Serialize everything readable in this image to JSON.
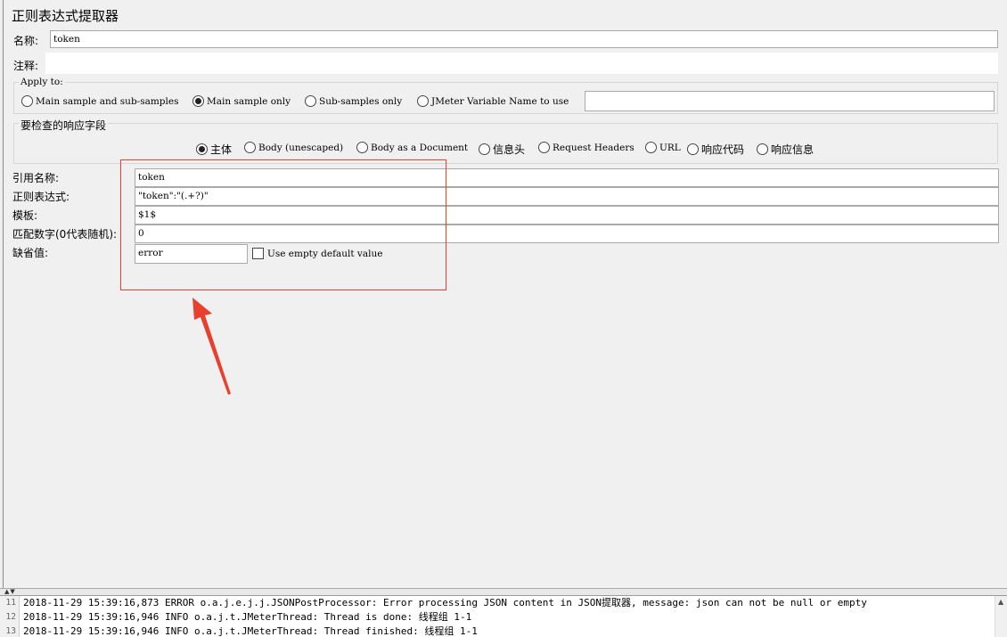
{
  "panel": {
    "title": "正则表达式提取器"
  },
  "name_field": {
    "label": "名称:",
    "value": "token"
  },
  "comment_field": {
    "label": "注释:",
    "value": ""
  },
  "apply_to": {
    "legend": "Apply to:",
    "options": [
      "Main sample and sub-samples",
      "Main sample only",
      "Sub-samples only",
      "JMeter Variable Name to use"
    ],
    "selected": "Main sample only",
    "variable_name": ""
  },
  "response_field": {
    "legend": "要检查的响应字段",
    "options": [
      "主体",
      "Body (unescaped)",
      "Body as a Document",
      "信息头",
      "Request Headers",
      "URL",
      "响应代码",
      "响应信息"
    ],
    "selected": "主体"
  },
  "params": {
    "ref_name": {
      "label": "引用名称:",
      "value": "token"
    },
    "regex": {
      "label": "正则表达式:",
      "value": "\"token\":\"(.+?)\""
    },
    "template": {
      "label": "模板:",
      "value": "$1$"
    },
    "match_no": {
      "label": "匹配数字(0代表随机):",
      "value": "0"
    },
    "default": {
      "label": "缺省值:",
      "value": "error"
    },
    "use_empty_default": {
      "label": "Use empty default value",
      "checked": false
    }
  },
  "annotation": {
    "color": "#e8402f"
  },
  "log": {
    "line_numbers": [
      "11",
      "12",
      "13"
    ],
    "lines": [
      "2018-11-29 15:39:16,873 ERROR o.a.j.e.j.j.JSONPostProcessor: Error processing JSON content in JSON提取器, message: json can not be null or empty",
      "2018-11-29 15:39:16,946 INFO o.a.j.t.JMeterThread: Thread is done: 线程组 1-1",
      "2018-11-29 15:39:16,946 INFO o.a.j.t.JMeterThread: Thread finished: 线程组 1-1"
    ]
  }
}
